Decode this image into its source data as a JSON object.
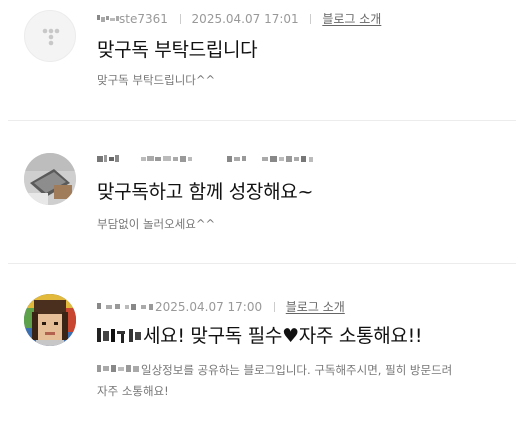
{
  "comments": [
    {
      "author": "ste7361",
      "date": "2025.04.07 17:01",
      "link_label": "블로그 소개",
      "title": "맞구독 부탁드립니다",
      "description": "맞구독 부탁드립니다^^"
    },
    {
      "author": "",
      "date": "",
      "link_label": "",
      "title": "맞구독하고 함께 성장해요~",
      "description": "부담없이 놀러오세요^^"
    },
    {
      "author": "",
      "date": "2025.04.07 17:00",
      "link_label": "블로그 소개",
      "title_a": "세요! 맞구독 필수",
      "heart": "♥",
      "title_b": "자주 소통해요!!",
      "description_a": "일상정보를 공유하는 블로그입니다. 구독해주시면, 필히 방문드려",
      "description_b": "자주 소통해요!"
    }
  ],
  "colors": {
    "meta": "#999999",
    "link": "#666666",
    "title": "#111111",
    "description": "#777777",
    "divider": "#ececec"
  },
  "icons": {
    "default_avatar": "t-logo-icon",
    "blurred_text": "pixelated-text"
  }
}
